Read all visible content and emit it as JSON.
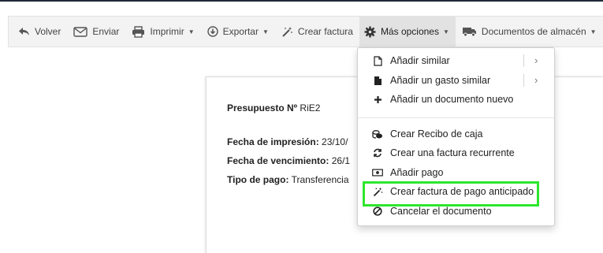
{
  "toolbar": {
    "volver": "Volver",
    "enviar": "Enviar",
    "imprimir": "Imprimir",
    "exportar": "Exportar",
    "crear_factura": "Crear factura",
    "mas_opciones": "Más opciones",
    "documentos_almacen": "Documentos de almacén"
  },
  "document": {
    "presupuesto_label": "Presupuesto Nº",
    "presupuesto_value": "RiE2",
    "fecha_impresion_label": "Fecha de impresión:",
    "fecha_impresion_value": "23/10/",
    "fecha_vencimiento_label": "Fecha de vencimiento:",
    "fecha_vencimiento_value": "26/1",
    "tipo_pago_label": "Tipo de pago:",
    "tipo_pago_value": "Transferencia"
  },
  "menu": {
    "items": [
      {
        "label": "Añadir similar",
        "icon": "file-outline-icon",
        "submenu": true
      },
      {
        "label": "Añadir un gasto similar",
        "icon": "file-solid-icon",
        "submenu": true
      },
      {
        "label": "Añadir un documento nuevo",
        "icon": "plus-icon",
        "submenu": false
      },
      {
        "label": "Crear Recibo de caja",
        "icon": "coins-icon",
        "submenu": false
      },
      {
        "label": "Crear una factura recurrente",
        "icon": "sync-icon",
        "submenu": false
      },
      {
        "label": "Añadir pago",
        "icon": "money-bill-icon",
        "submenu": false
      },
      {
        "label": "Crear factura de pago anticipado",
        "icon": "magic-wand-icon",
        "submenu": false
      },
      {
        "label": "Cancelar el documento",
        "icon": "ban-icon",
        "submenu": false
      }
    ]
  },
  "colors": {
    "toolbar_bg": "#f3f3f3",
    "active_bg": "#e2e2e2",
    "highlight": "#2ee62e",
    "topline": "#1f2a36"
  }
}
